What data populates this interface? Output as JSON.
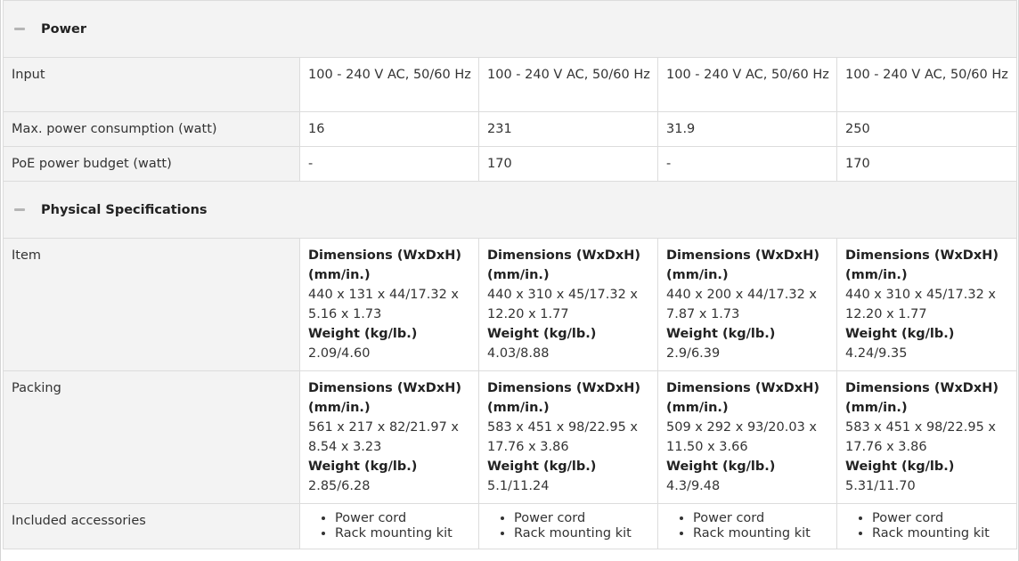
{
  "sections": {
    "power": {
      "title": "Power"
    },
    "physical": {
      "title": "Physical Specifications"
    }
  },
  "power_rows": {
    "input": {
      "label": "Input",
      "values": [
        "100 - 240 V AC, 50/60 Hz",
        "100 - 240 V AC, 50/60 Hz",
        "100 - 240 V AC, 50/60 Hz",
        "100 - 240 V AC, 50/60 Hz"
      ]
    },
    "max_power": {
      "label": "Max. power consumption (watt)",
      "values": [
        "16",
        "231",
        "31.9",
        "250"
      ]
    },
    "poe_budget": {
      "label": "PoE power budget (watt)",
      "values": [
        "-",
        "170",
        "-",
        "170"
      ]
    }
  },
  "physical_rows": {
    "dimension_heading": "Dimensions (WxDxH) (mm/in.)",
    "weight_heading": "Weight (kg/lb.)",
    "item": {
      "label": "Item",
      "dims": [
        "440 x 131 x 44/17.32 x 5.16 x 1.73",
        "440 x 310 x 45/17.32 x 12.20 x 1.77",
        "440 x 200 x 44/17.32 x 7.87 x 1.73",
        "440 x 310 x 45/17.32 x 12.20 x 1.77"
      ],
      "weights": [
        "2.09/4.60",
        "4.03/8.88",
        "2.9/6.39",
        "4.24/9.35"
      ]
    },
    "packing": {
      "label": "Packing",
      "dims": [
        "561 x 217 x 82/21.97 x 8.54 x 3.23",
        "583 x 451 x 98/22.95 x 17.76 x 3.86",
        "509 x 292 x 93/20.03 x 11.50 x 3.66",
        "583 x 451 x 98/22.95 x 17.76 x 3.86"
      ],
      "weights": [
        "2.85/6.28",
        "5.1/11.24",
        "4.3/9.48",
        "5.31/11.70"
      ]
    },
    "accessories": {
      "label": "Included accessories",
      "items": [
        "Power cord",
        "Rack mounting kit"
      ]
    }
  }
}
